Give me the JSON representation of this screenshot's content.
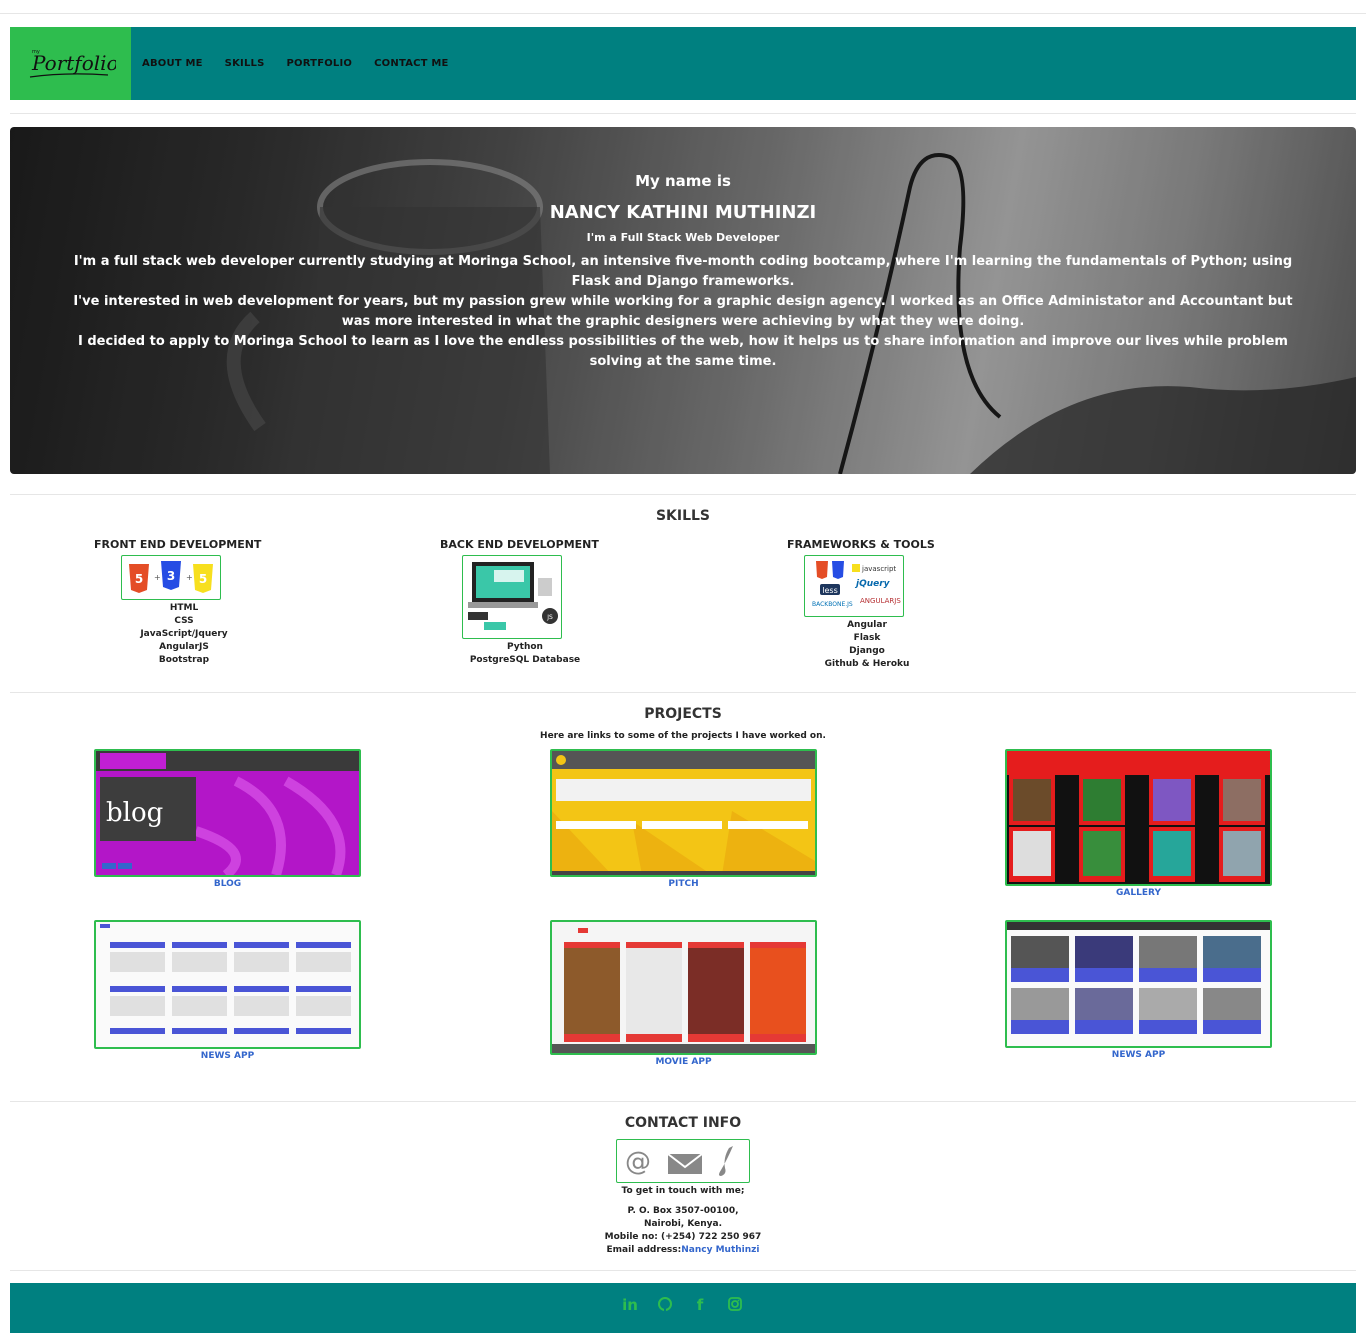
{
  "nav": {
    "logo_text": "Portfolio",
    "logo_small": "my",
    "links": [
      "ABOUT ME",
      "SKILLS",
      "PORTFOLIO",
      "CONTACT ME"
    ]
  },
  "hero": {
    "intro": "My name is",
    "name": "NANCY KATHINI MUTHINZI",
    "role": "I'm a Full Stack Web Developer",
    "bio": [
      "I'm a full stack web developer currently studying at Moringa School, an intensive five-month coding bootcamp, where I'm learning the fundamentals of Python; using Flask and Django frameworks.",
      "I've interested in web development for years, but my passion grew while working for a graphic design agency. I worked as an Office Administator and Accountant but was more interested in what the graphic designers were achieving by what they were doing.",
      "I decided to apply to Moringa School to learn as I love the endless possibilities of the web, how it helps us to share information and improve our lives while problem solving at the same time."
    ]
  },
  "skills": {
    "title": "SKILLS",
    "columns": [
      {
        "heading": "FRONT END DEVELOPMENT",
        "items": [
          "HTML",
          "CSS",
          "JavaScript/Jquery",
          "AngularJS",
          "Bootstrap"
        ]
      },
      {
        "heading": "BACK END DEVELOPMENT",
        "items": [
          "Python",
          "PostgreSQL Database"
        ]
      },
      {
        "heading": "FRAMEWORKS & TOOLS",
        "items": [
          "Angular",
          "Flask",
          "Django",
          "Github & Heroku"
        ]
      }
    ]
  },
  "projects": {
    "title": "PROJECTS",
    "subtitle": "Here are links to some of the projects I have worked on.",
    "items": [
      {
        "label": "BLOG"
      },
      {
        "label": "PITCH"
      },
      {
        "label": "GALLERY"
      },
      {
        "label": "NEWS APP"
      },
      {
        "label": "MOVIE APP"
      },
      {
        "label": "NEWS APP"
      }
    ]
  },
  "contact": {
    "title": "CONTACT INFO",
    "intro": "To get in touch with me;",
    "address_line1": "P. O. Box 3507-00100,",
    "address_line2": "Nairobi, Kenya.",
    "mobile": "Mobile no: (+254) 722 250 967",
    "email_label": "Email address:",
    "email_link": "Nancy Muthinzi"
  },
  "footer": {
    "social_icons": [
      "linkedin-icon",
      "github-icon",
      "facebook-icon",
      "instagram-icon"
    ]
  },
  "colors": {
    "teal": "#008080",
    "green": "#2ebd4e",
    "link": "#3366cc"
  }
}
